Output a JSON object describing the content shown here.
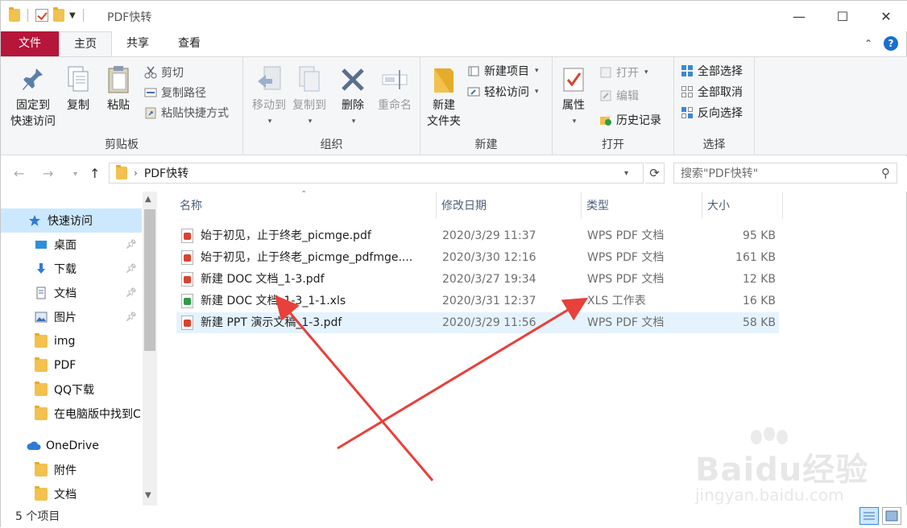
{
  "window": {
    "title": "PDF快转",
    "controls": {
      "minimize": "—",
      "maximize": "☐",
      "close": "✕"
    }
  },
  "ribbon_tabs": [
    {
      "label": "文件"
    },
    {
      "label": "主页"
    },
    {
      "label": "共享"
    },
    {
      "label": "查看"
    }
  ],
  "ribbon": {
    "clipboard": {
      "label": "剪贴板",
      "pin_line1": "固定到",
      "pin_line2": "快速访问",
      "copy": "复制",
      "paste": "粘贴",
      "cut": "剪切",
      "copy_path": "复制路径",
      "paste_shortcut": "粘贴快捷方式"
    },
    "organize": {
      "label": "组织",
      "move_to": "移动到",
      "copy_to": "复制到",
      "delete": "删除",
      "rename": "重命名"
    },
    "new": {
      "label": "新建",
      "new_item": "新建项目",
      "easy_access": "轻松访问",
      "new_folder_line1": "新建",
      "new_folder_line2": "文件夹"
    },
    "open": {
      "label": "打开",
      "properties": "属性",
      "open": "打开",
      "edit": "编辑",
      "history": "历史记录"
    },
    "select": {
      "label": "选择",
      "select_all": "全部选择",
      "select_none": "全部取消",
      "invert": "反向选择"
    }
  },
  "address": {
    "crumb": "PDF快转",
    "search_placeholder": "搜索\"PDF快转\""
  },
  "nav": {
    "items": [
      {
        "label": "快速访问",
        "icon": "star-icon"
      },
      {
        "label": "桌面",
        "icon": "desktop-icon"
      },
      {
        "label": "下载",
        "icon": "download-icon"
      },
      {
        "label": "文档",
        "icon": "document-icon"
      },
      {
        "label": "图片",
        "icon": "picture-icon"
      },
      {
        "label": "img",
        "icon": "folder-icon"
      },
      {
        "label": "PDF",
        "icon": "folder-icon"
      },
      {
        "label": "QQ下载",
        "icon": "folder-icon"
      },
      {
        "label": "在电脑版中找到C",
        "icon": "folder-icon"
      },
      {
        "label": "OneDrive",
        "icon": "cloud-icon"
      },
      {
        "label": "附件",
        "icon": "folder-icon"
      },
      {
        "label": "文档",
        "icon": "folder-icon"
      }
    ]
  },
  "columns": {
    "name": "名称",
    "date": "修改日期",
    "type": "类型",
    "size": "大小"
  },
  "files": [
    {
      "name": "始于初见，止于终老_picmge.pdf",
      "date": "2020/3/29 11:37",
      "type": "WPS PDF 文档",
      "size": "95 KB",
      "kind": "pdf"
    },
    {
      "name": "始于初见，止于终老_picmge_pdfmge....",
      "date": "2020/3/30 12:16",
      "type": "WPS PDF 文档",
      "size": "161 KB",
      "kind": "pdf"
    },
    {
      "name": "新建 DOC 文档_1-3.pdf",
      "date": "2020/3/27 19:34",
      "type": "WPS PDF 文档",
      "size": "12 KB",
      "kind": "pdf"
    },
    {
      "name": "新建 DOC 文档_1-3_1-1.xls",
      "date": "2020/3/31 12:37",
      "type": "XLS 工作表",
      "size": "16 KB",
      "kind": "xls"
    },
    {
      "name": "新建 PPT 演示文稿_1-3.pdf",
      "date": "2020/3/29 11:56",
      "type": "WPS PDF 文档",
      "size": "58 KB",
      "kind": "pdf"
    }
  ],
  "status": {
    "count": "5 个项目"
  },
  "watermark": {
    "logo": "Baidu经验",
    "url": "jingyan.baidu.com"
  },
  "colors": {
    "file_tab": "#b5163a",
    "selection": "#cce8ff",
    "arrow": "#e8403a",
    "pdf": "#d9432f",
    "xls": "#2e9b4a"
  }
}
